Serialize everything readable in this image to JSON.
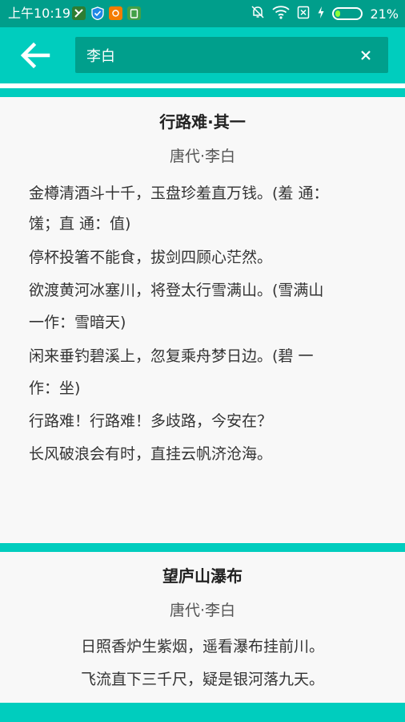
{
  "status_bar": {
    "time": "上午10:19",
    "battery_percent": "21%",
    "battery_level": 0.21,
    "app_icons": [
      "messages-app-icon",
      "shield-app-icon",
      "game-app-icon",
      "android-app-icon"
    ],
    "status_icons": [
      "mute-bell-icon",
      "wifi-icon",
      "no-sim-icon",
      "charging-icon",
      "battery-icon"
    ]
  },
  "toolbar": {
    "back_icon": "back-arrow-icon",
    "search_value": "李白",
    "clear_icon": "close-icon"
  },
  "colors": {
    "accent": "#00cdbe",
    "accent_dark": "#009e8b",
    "card_bg": "#f8f8f8"
  },
  "poems": [
    {
      "title": "行路难·其一",
      "author": "唐代·李白",
      "lines": [
        "金樽清酒斗十千，玉盘珍羞直万钱。(羞 通：",
        "馐；直 通：值)",
        "停杯投箸不能食，拔剑四顾心茫然。",
        "欲渡黄河冰塞川，将登太行雪满山。(雪满山",
        "一作：雪暗天)",
        "闲来垂钓碧溪上，忽复乘舟梦日边。(碧 一",
        "作：坐)",
        "行路难！行路难！多歧路，今安在？",
        "长风破浪会有时，直挂云帆济沧海。"
      ]
    },
    {
      "title": "望庐山瀑布",
      "author": "唐代·李白",
      "lines": [
        "日照香炉生紫烟，遥看瀑布挂前川。",
        "飞流直下三千尺，疑是银河落九天。"
      ]
    }
  ]
}
